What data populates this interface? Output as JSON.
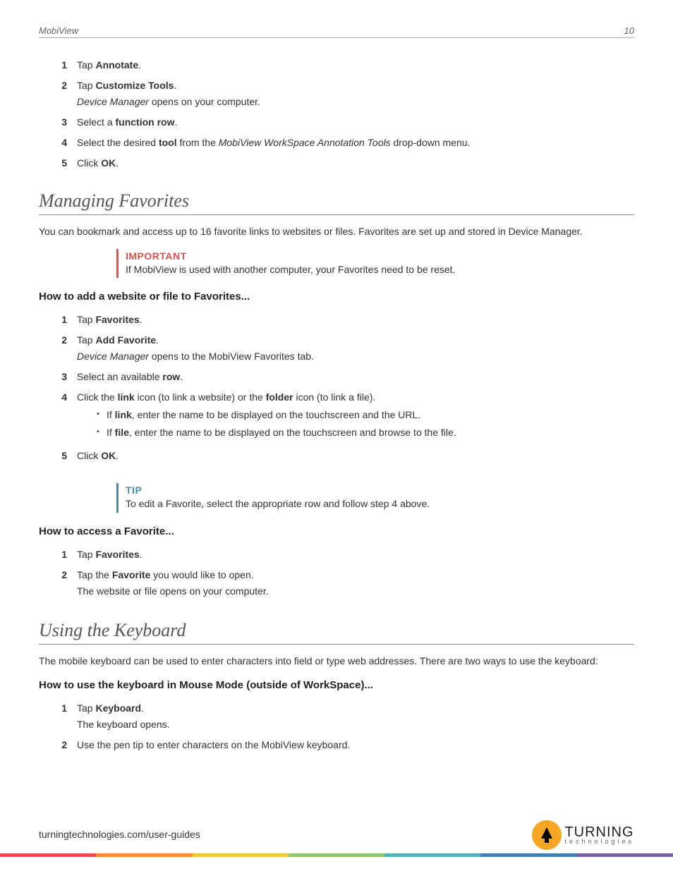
{
  "header": {
    "title": "MobiView",
    "page_number": "10"
  },
  "first_list": [
    {
      "n": "1",
      "html": "Tap <strong>Annotate</strong>."
    },
    {
      "n": "2",
      "html": "Tap <strong>Customize Tools</strong>.",
      "sub_html": "<em>Device Manager</em> opens on your computer."
    },
    {
      "n": "3",
      "html": "Select a <strong>function row</strong>."
    },
    {
      "n": "4",
      "html": "Select the desired <strong>tool</strong> from the <em>MobiView WorkSpace Annotation Tools</em> drop-down menu."
    },
    {
      "n": "5",
      "html": "Click <strong>OK</strong>."
    }
  ],
  "section_favorites": {
    "heading": "Managing Favorites",
    "intro": "You can bookmark and access up to 16 favorite links to websites or files. Favorites are set up and stored in Device Manager.",
    "important": {
      "title": "IMPORTANT",
      "body": "If MobiView is used with another computer, your Favorites need to be reset."
    },
    "howto_add": {
      "title": "How to add a website or file to Favorites...",
      "steps": [
        {
          "n": "1",
          "html": "Tap <strong>Favorites</strong>."
        },
        {
          "n": "2",
          "html": "Tap <strong>Add Favorite</strong>.",
          "sub_html": "<em>Device Manager</em> opens to the MobiView Favorites tab."
        },
        {
          "n": "3",
          "html": "Select an available <strong>row</strong>."
        },
        {
          "n": "4",
          "html": "Click the <strong>link</strong> icon (to link a website) or the <strong>folder</strong> icon (to link a file).",
          "bullets": [
            "If <strong>link</strong>, enter the name to be displayed on the touchscreen and the URL.",
            "If <strong>file</strong>, enter the name to be displayed on the touchscreen and browse to the file."
          ]
        },
        {
          "n": "5",
          "html": "Click <strong>OK</strong>."
        }
      ]
    },
    "tip": {
      "title": "TIP",
      "body": "To edit a Favorite, select the appropriate row and follow step 4 above."
    },
    "howto_access": {
      "title": "How to access a Favorite...",
      "steps": [
        {
          "n": "1",
          "html": "Tap <strong>Favorites</strong>."
        },
        {
          "n": "2",
          "html": "Tap the <strong>Favorite</strong> you would like to open.",
          "sub_html": "The website or file opens on your computer."
        }
      ]
    }
  },
  "section_keyboard": {
    "heading": "Using the Keyboard",
    "intro": "The mobile keyboard can be used to enter characters into field or type web addresses. There are two ways to use the keyboard:",
    "howto_mouse": {
      "title": "How to use the keyboard in Mouse Mode (outside of WorkSpace)...",
      "steps": [
        {
          "n": "1",
          "html": "Tap <strong>Keyboard</strong>.",
          "sub_html": "The keyboard opens."
        },
        {
          "n": "2",
          "html": "Use the pen tip to enter characters on the MobiView keyboard."
        }
      ]
    }
  },
  "footer": {
    "url": "turningtechnologies.com/user-guides",
    "logo_main": "TURNING",
    "logo_sub": "technologies"
  }
}
